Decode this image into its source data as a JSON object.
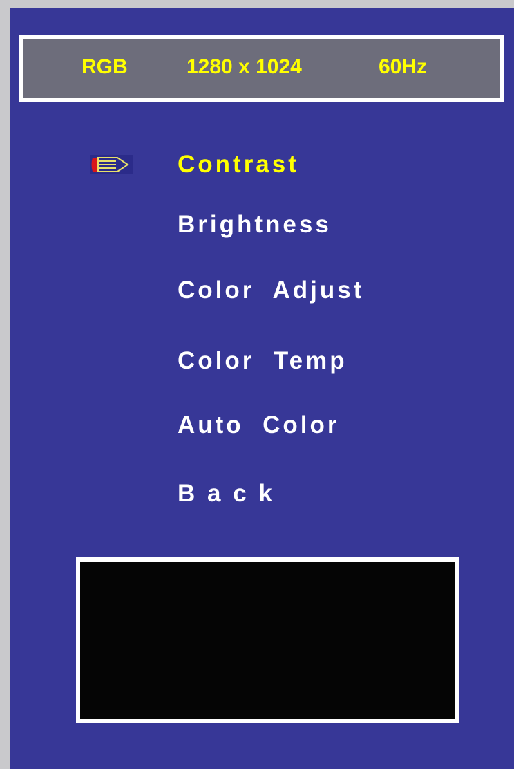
{
  "info": {
    "signal": "RGB",
    "resolution": "1280 x 1024",
    "refresh": "60Hz"
  },
  "menu": {
    "selected_index": 0,
    "items": [
      {
        "label": "Contrast"
      },
      {
        "label": "Brightness"
      },
      {
        "label": "Color  Adjust"
      },
      {
        "label": "Color  Temp"
      },
      {
        "label": "Auto  Color"
      },
      {
        "label": "B a c k"
      }
    ],
    "pointer_icon": "pencil-icon"
  },
  "colors": {
    "background": "#373797",
    "info_bar": "#6d6d7b",
    "selected_text": "#ffff00",
    "text": "#ffffff",
    "preview": "#050505"
  }
}
